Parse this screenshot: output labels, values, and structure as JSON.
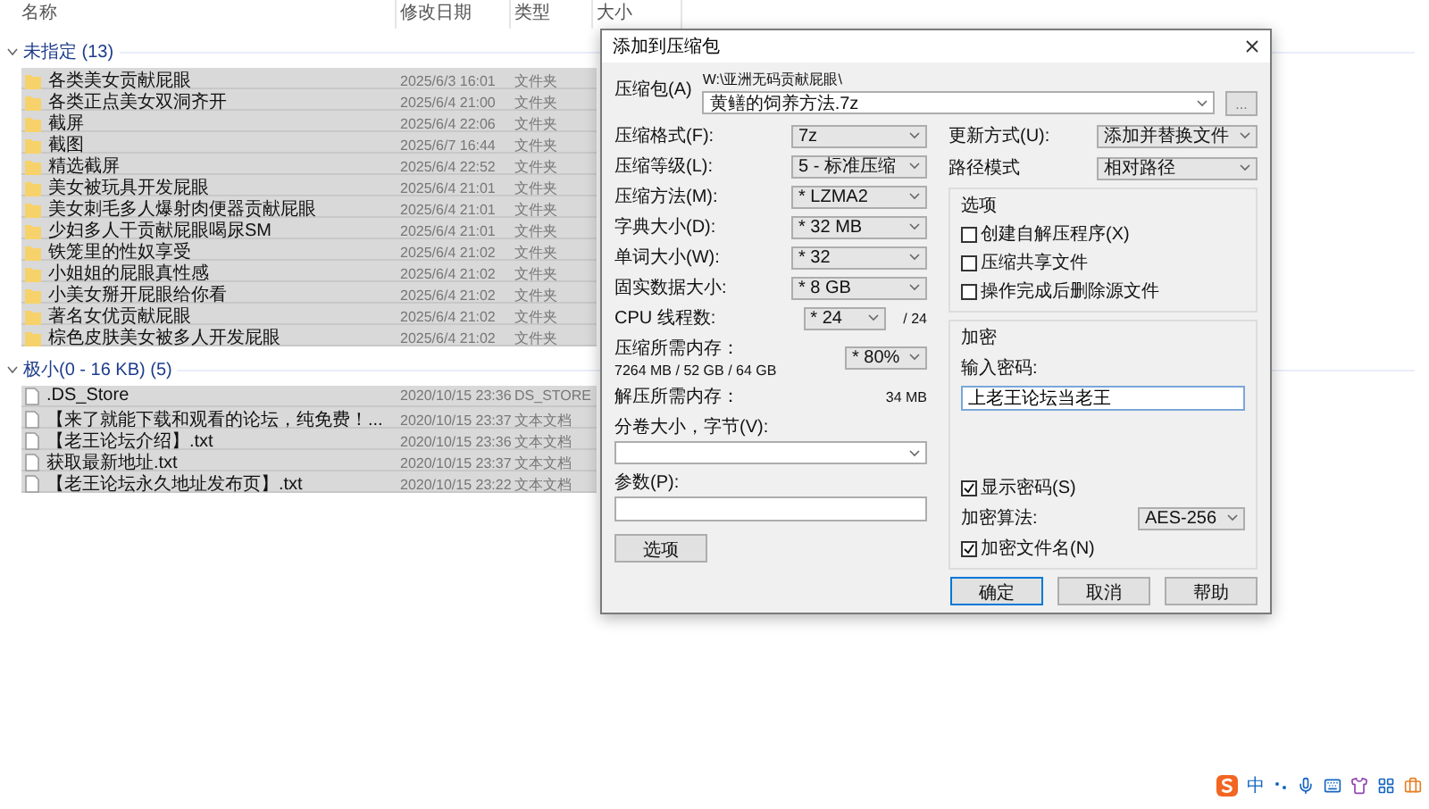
{
  "explorer": {
    "columns": [
      "名称",
      "修改日期",
      "类型",
      "大小"
    ],
    "groups": [
      {
        "title": "未指定 (13)",
        "expanded": true,
        "rows": [
          {
            "kind": "folder",
            "name": "各类美女贡献屁眼",
            "modified": "2025/6/3 16:01",
            "type": "文件夹",
            "selected": true
          },
          {
            "kind": "folder",
            "name": "各类正点美女双洞齐开",
            "modified": "2025/6/4 21:00",
            "type": "文件夹",
            "selected": true
          },
          {
            "kind": "folder",
            "name": "截屏",
            "modified": "2025/6/4 22:06",
            "type": "文件夹",
            "selected": true
          },
          {
            "kind": "folder",
            "name": "截图",
            "modified": "2025/6/7 16:44",
            "type": "文件夹",
            "selected": true
          },
          {
            "kind": "folder",
            "name": "精选截屏",
            "modified": "2025/6/4 22:52",
            "type": "文件夹",
            "selected": true
          },
          {
            "kind": "folder",
            "name": "美女被玩具开发屁眼",
            "modified": "2025/6/4 21:01",
            "type": "文件夹",
            "selected": true
          },
          {
            "kind": "folder",
            "name": "美女刺毛多人爆射肉便器贡献屁眼",
            "modified": "2025/6/4 21:01",
            "type": "文件夹",
            "selected": true
          },
          {
            "kind": "folder",
            "name": "少妇多人干贡献屁眼喝尿SM",
            "modified": "2025/6/4 21:01",
            "type": "文件夹",
            "selected": true
          },
          {
            "kind": "folder",
            "name": "铁笼里的性奴享受",
            "modified": "2025/6/4 21:02",
            "type": "文件夹",
            "selected": true
          },
          {
            "kind": "folder",
            "name": "小姐姐的屁眼真性感",
            "modified": "2025/6/4 21:02",
            "type": "文件夹",
            "selected": true
          },
          {
            "kind": "folder",
            "name": "小美女掰开屁眼给你看",
            "modified": "2025/6/4 21:02",
            "type": "文件夹",
            "selected": true
          },
          {
            "kind": "folder",
            "name": "著名女优贡献屁眼",
            "modified": "2025/6/4 21:02",
            "type": "文件夹",
            "selected": true
          },
          {
            "kind": "folder",
            "name": "棕色皮肤美女被多人开发屁眼",
            "modified": "2025/6/4 21:02",
            "type": "文件夹",
            "selected": true
          }
        ]
      },
      {
        "title": "极小(0 - 16 KB) (5)",
        "expanded": true,
        "rows": [
          {
            "kind": "file",
            "name": ".DS_Store",
            "modified": "2020/10/15 23:36",
            "type": "DS_STORE",
            "selected": true
          },
          {
            "kind": "file",
            "name": "【来了就能下载和观看的论坛，纯免费！...",
            "modified": "2020/10/15 23:37",
            "type": "文本文档",
            "selected": true
          },
          {
            "kind": "file",
            "name": "【老王论坛介绍】.txt",
            "modified": "2020/10/15 23:36",
            "type": "文本文档",
            "selected": true
          },
          {
            "kind": "file",
            "name": "获取最新地址.txt",
            "modified": "2020/10/15 23:37",
            "type": "文本文档",
            "selected": true
          },
          {
            "kind": "file",
            "name": "【老王论坛永久地址发布页】.txt",
            "modified": "2020/10/15 23:22",
            "type": "文本文档",
            "selected": true
          }
        ]
      }
    ]
  },
  "dialog": {
    "title": "添加到压缩包",
    "archive": {
      "label": "压缩包(A)",
      "path": "W:\\亚洲无码贡献屁眼\\",
      "value": "黄鳝的饲养方法.7z",
      "browse": "..."
    },
    "left_fields": [
      {
        "kind": "combo",
        "label": "压缩格式(F):",
        "value": "7z"
      },
      {
        "kind": "combo",
        "label": "压缩等级(L):",
        "value": "5 - 标准压缩"
      },
      {
        "kind": "combo",
        "label": "压缩方法(M):",
        "value": "* LZMA2"
      },
      {
        "kind": "combo",
        "label": "字典大小(D):",
        "value": "* 32 MB"
      },
      {
        "kind": "combo",
        "label": "单词大小(W):",
        "value": "* 32"
      },
      {
        "kind": "combo",
        "label": "固实数据大小:",
        "value": "* 8 GB"
      },
      {
        "kind": "threads",
        "label": "CPU 线程数:",
        "value": "* 24",
        "note": "/ 24"
      },
      {
        "kind": "memory",
        "label": "压缩所需内存：",
        "detail": "7264 MB / 52 GB / 64 GB",
        "value": "* 80%"
      },
      {
        "kind": "text",
        "label": "解压所需内存：",
        "value": "34 MB"
      },
      {
        "kind": "wide_combo",
        "label": "分卷大小，字节(V):"
      },
      {
        "kind": "wide_input",
        "label": "参数(P):"
      }
    ],
    "options_button": "选项",
    "right_fields": [
      {
        "label": "更新方式(U):",
        "value": "添加并替换文件"
      },
      {
        "label": "路径模式",
        "value": "相对路径"
      }
    ],
    "options": {
      "title": "选项",
      "items": [
        {
          "label": "创建自解压程序(X)",
          "checked": false
        },
        {
          "label": "压缩共享文件",
          "checked": false
        },
        {
          "label": "操作完成后删除源文件",
          "checked": false
        }
      ]
    },
    "encryption": {
      "title": "加密",
      "password_label": "输入密码:",
      "password": "上老王论坛当老王",
      "show_password": {
        "label": "显示密码(S)",
        "checked": true
      },
      "method_label": "加密算法:",
      "method": "AES-256",
      "encrypt_names": {
        "label": "加密文件名(N)",
        "checked": true
      }
    },
    "buttons": [
      {
        "label": "确定",
        "default": true
      },
      {
        "label": "取消",
        "default": false
      },
      {
        "label": "帮助",
        "default": false
      }
    ]
  },
  "tray": {
    "ime_mode": "中"
  }
}
